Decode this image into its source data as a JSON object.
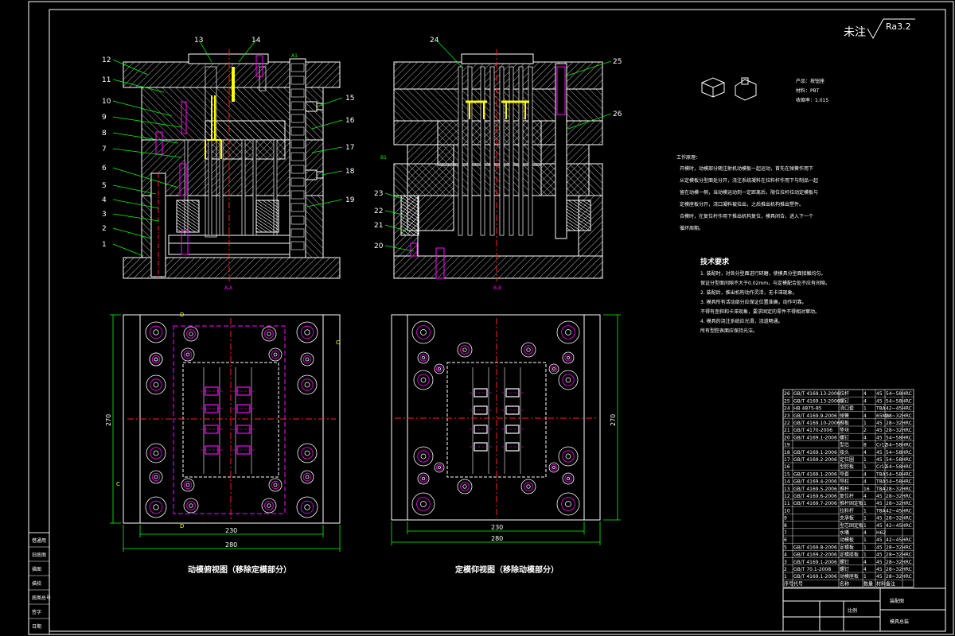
{
  "roughness": {
    "label": "未注",
    "value": "Ra3.2"
  },
  "product_info": {
    "name": "产品：按钮座",
    "material": "材料：PBT",
    "shrinkage": "收缩率：1.015"
  },
  "process_title": "工作原理：",
  "process_lines": [
    "开模时，动模部分随注射机动模板一起运动，首先在弹簧作用下",
    "从定模板分型面处分开，浇注系统凝料在拉料杆作用下与制品一起",
    "留在动模一侧，当动模运动到一定距离后，限位拉杆拉动定模板与",
    "定模座板分开，浇口凝料被拉出，之后推出机构推出塑件。",
    "合模时，在复位杆作用下推出机构复位，模具闭合，进入下一个",
    "循环周期。"
  ],
  "tech_title": "技术要求",
  "tech_lines": [
    "1. 装配时，对各分型面进行研磨，使模具分型面接触均匀。",
    "保证分型面间隙不大于0.02mm，与定模配合处不应有间隙。",
    "2. 装配后，推出机构动作灵活，无卡滞现象。",
    "3. 模具所有活动部分应保证位置准确，动作可靠。",
    "不得有歪斜和卡滞现象，要求固定的零件不得相对窜动。",
    "4. 模具的浇注系统应光滑，流道畅通。",
    "所有型腔表面应保持光洁。"
  ],
  "view_captions": {
    "left_section": "A-A",
    "right_section": "B-B",
    "left_plan": "动模俯视图（移除定模部分）",
    "right_plan": "定模仰视图（移除动模部分）"
  },
  "dimensions": {
    "left_height": "270",
    "right_height": "270",
    "left_inner_width": "230",
    "left_outer_width": "280",
    "right_inner_width": "230",
    "right_outer_width": "280"
  },
  "section_markers": {
    "d": "D",
    "c": "C"
  },
  "callouts_left": [
    "1",
    "2",
    "3",
    "4",
    "5",
    "6",
    "7",
    "8",
    "9",
    "10",
    "11",
    "12",
    "13",
    "14",
    "15",
    "16",
    "17",
    "18",
    "19"
  ],
  "callouts_right": [
    "20",
    "21",
    "22",
    "23",
    "24",
    "25",
    "26"
  ],
  "bom_rows": [
    {
      "no": "26",
      "std": "GB/T 4169.13-2006",
      "name": "拉杆",
      "qty": "4",
      "mat": "45",
      "note": "54~58HRC"
    },
    {
      "no": "25",
      "std": "GB/T 4169.13-2006",
      "name": "螺钉",
      "qty": "4",
      "mat": "45",
      "note": "54~58HRC"
    },
    {
      "no": "24",
      "std": "HB 4875-85",
      "name": "浇口套",
      "qty": "1",
      "mat": "T8A",
      "note": "42~45HRC"
    },
    {
      "no": "23",
      "std": "GB/T 4169.9-2006",
      "name": "弹簧",
      "qty": "4",
      "mat": "65Mn",
      "note": "28~32HRC"
    },
    {
      "no": "22",
      "std": "GB/T 4169.10-2006",
      "name": "推板",
      "qty": "1",
      "mat": "45",
      "note": "28~32HRC"
    },
    {
      "no": "21",
      "std": "GB/T 4170-2006",
      "name": "垫块",
      "qty": "2",
      "mat": "45",
      "note": "28~32HRC"
    },
    {
      "no": "20",
      "std": "GB/T 4169.1-2006",
      "name": "螺钉",
      "qty": "4",
      "mat": "45",
      "note": "54~58HRC"
    },
    {
      "no": "19",
      "std": "",
      "name": "型芯",
      "qty": "8",
      "mat": "Cr12",
      "note": "54~58HRC"
    },
    {
      "no": "18",
      "std": "GB/T 4169.1-2006",
      "name": "接头",
      "qty": "4",
      "mat": "45",
      "note": "54~58HRC"
    },
    {
      "no": "17",
      "std": "GB/T 4169.2-2006",
      "name": "定位圈",
      "qty": "1",
      "mat": "45",
      "note": "54~58HRC"
    },
    {
      "no": "16",
      "std": "",
      "name": "型腔板",
      "qty": "1",
      "mat": "Cr12",
      "note": "54~58HRC"
    },
    {
      "no": "15",
      "std": "GB/T 4169.1-2006",
      "name": "导套",
      "qty": "4",
      "mat": "T8A",
      "note": "54~58HRC"
    },
    {
      "no": "14",
      "std": "GB/T 4169.4-2006",
      "name": "导柱",
      "qty": "4",
      "mat": "T8A",
      "note": "54~58HRC"
    },
    {
      "no": "13",
      "std": "GB/T 4169.5-2006",
      "name": "推杆",
      "qty": "16",
      "mat": "T8A",
      "note": "28~32HRC"
    },
    {
      "no": "12",
      "std": "GB/T 4169.6-2006",
      "name": "复位杆",
      "qty": "4",
      "mat": "45",
      "note": "28~32HRC"
    },
    {
      "no": "11",
      "std": "GB/T 4169.7-2006",
      "name": "推杆固定板",
      "qty": "1",
      "mat": "45",
      "note": "28~32HRC"
    },
    {
      "no": "10",
      "std": "",
      "name": "拉料杆",
      "qty": "1",
      "mat": "T8A",
      "note": "42~45HRC"
    },
    {
      "no": "9",
      "std": "",
      "name": "支承板",
      "qty": "1",
      "mat": "45",
      "note": "28~32HRC"
    },
    {
      "no": "8",
      "std": "",
      "name": "型芯固定板",
      "qty": "1",
      "mat": "45",
      "note": "42~45HRC"
    },
    {
      "no": "7",
      "std": "",
      "name": "水嘴",
      "qty": "4",
      "mat": "H62",
      "note": ""
    },
    {
      "no": "6",
      "std": "",
      "name": "动模板",
      "qty": "1",
      "mat": "45",
      "note": "42~45HRC"
    },
    {
      "no": "5",
      "std": "GB/T 4169.8-2006",
      "name": "定模板",
      "qty": "1",
      "mat": "45",
      "note": "28~32HRC"
    },
    {
      "no": "4",
      "std": "GB/T 4169.2-2006",
      "name": "定模座板",
      "qty": "1",
      "mat": "45",
      "note": "28~32HRC"
    },
    {
      "no": "3",
      "std": "GB/T 4169.1-2006",
      "name": "螺钉",
      "qty": "4",
      "mat": "45",
      "note": "28~32HRC"
    },
    {
      "no": "2",
      "std": "GB/T 70.1-2008",
      "name": "螺钉",
      "qty": "4",
      "mat": "45",
      "note": "28~32HRC"
    },
    {
      "no": "1",
      "std": "GB/T 4169.1-2006",
      "name": "动模座板",
      "qty": "1",
      "mat": "45",
      "note": "28~32HRC"
    }
  ],
  "bom_header": [
    "序号",
    "代号",
    "名称",
    "数量",
    "材料",
    "备注"
  ],
  "title_block": {
    "title": "装配图",
    "drawing_no": "模具总装",
    "unit": "比例"
  },
  "left_strip": [
    "借通用",
    "旧底图",
    "描图",
    "描校",
    "底图总号",
    "签字",
    "日期"
  ],
  "colors": {
    "line": "#ffffff",
    "hatch": "#ffffff",
    "center": "#ff2020",
    "magenta": "#ff00ff",
    "yellow": "#ffff00",
    "green": "#00ff00",
    "accent": "#00ffff"
  }
}
